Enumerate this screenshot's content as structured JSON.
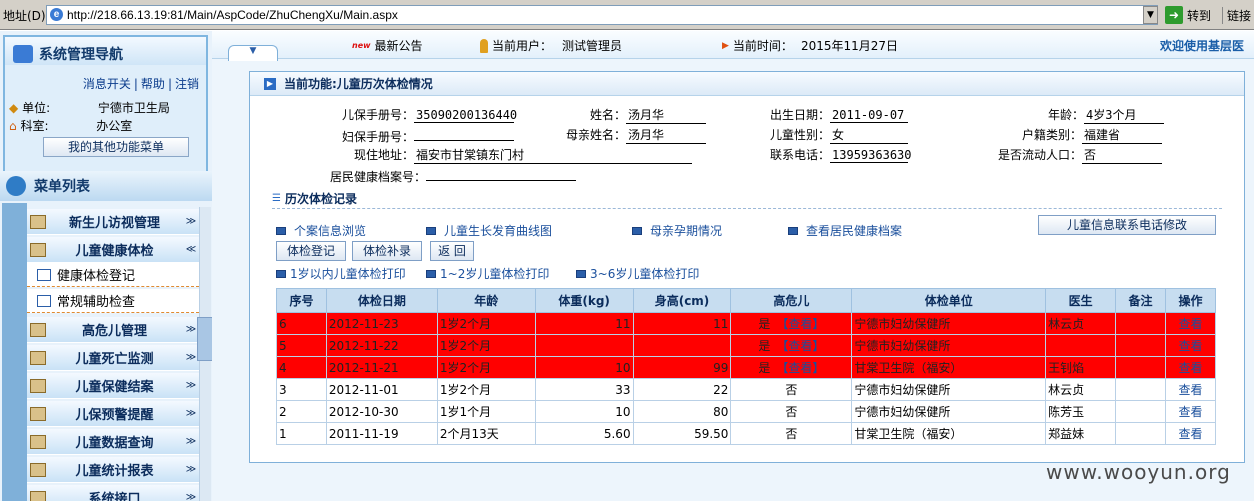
{
  "browser": {
    "address_label": "地址(D)",
    "url": "http://218.66.13.19:81/Main/AspCode/ZhuChengXu/Main.aspx",
    "go_label": "转到",
    "links_label": "链接"
  },
  "nav": {
    "title": "系统管理导航",
    "links": [
      "消息开关",
      "帮助",
      "注销"
    ],
    "unit_label": "单位:",
    "unit_value": "宁德市卫生局",
    "dept_label": "科室:",
    "dept_value": "办公室",
    "other_menu_button": "我的其他功能菜单",
    "menu_list_title": "菜单列表",
    "menu_items": [
      {
        "label": "新生儿访视管理",
        "chev": "≫"
      },
      {
        "label": "儿童健康体检",
        "chev": "≪"
      },
      {
        "label": "高危儿管理",
        "chev": "≫"
      },
      {
        "label": "儿童死亡监测",
        "chev": "≫"
      },
      {
        "label": "儿童保健结案",
        "chev": "≫"
      },
      {
        "label": "儿保预警提醒",
        "chev": "≫"
      },
      {
        "label": "儿童数据查询",
        "chev": "≫"
      },
      {
        "label": "儿童统计报表",
        "chev": "≫"
      },
      {
        "label": "系统接口",
        "chev": "≫"
      }
    ],
    "sub_items": [
      "健康体检登记",
      "常规辅助检查"
    ]
  },
  "topbar": {
    "new_badge": "new",
    "notice": "最新公告",
    "current_user_label": "当前用户：",
    "current_user": "测试管理员",
    "current_time_label": "当前时间：",
    "current_time": "2015年11月27日",
    "welcome": "欢迎使用基层医"
  },
  "panel": {
    "title": "当前功能:儿童历次体检情况",
    "fields": {
      "child_card_label": "儿保手册号：",
      "child_card": "35090200136440",
      "name_label": "姓名：",
      "name": "汤月华",
      "birth_label": "出生日期：",
      "birth": "2011-09-07",
      "age_label": "年龄：",
      "age": "4岁3个月",
      "mom_card_label": "妇保手册号：",
      "mom_card": "",
      "mom_name_label": "母亲姓名：",
      "mom_name": "汤月华",
      "gender_label": "儿童性别：",
      "gender": "女",
      "hukou_label": "户籍类别：",
      "hukou": "福建省",
      "addr_label": "现住地址：",
      "addr": "福安市甘棠镇东门村",
      "phone_label": "联系电话：",
      "phone": "13959363630",
      "floating_label": "是否流动人口：",
      "floating": "否",
      "health_file_label": "居民健康档案号：",
      "health_file": ""
    },
    "section_title": "历次体检记录",
    "links": [
      "个案信息浏览",
      "儿童生长发育曲线图",
      "母亲孕期情况",
      "查看居民健康档案"
    ],
    "phone_edit_button": "儿童信息联系电话修改",
    "buttons": [
      "体检登记",
      "体检补录",
      "返 回"
    ],
    "print_links": [
      "1岁以内儿童体检打印",
      "1~2岁儿童体检打印",
      "3~6岁儿童体检打印"
    ],
    "table": {
      "headers": [
        "序号",
        "体检日期",
        "年龄",
        "体重(kg)",
        "身高(cm)",
        "高危儿",
        "体检单位",
        "医生",
        "备注",
        "操作"
      ],
      "rows": [
        {
          "no": "6",
          "date": "2012-11-23",
          "age": "1岁2个月",
          "weight": "11",
          "height": "11",
          "risk": "是",
          "risk_link": "【查看】",
          "unit": "宁德市妇幼保健所",
          "doctor": "林云贞",
          "note": "",
          "op": "查看",
          "highlight": true
        },
        {
          "no": "5",
          "date": "2012-11-22",
          "age": "1岁2个月",
          "weight": "",
          "height": "",
          "risk": "是",
          "risk_link": "【查看】",
          "unit": "宁德市妇幼保健所",
          "doctor": "",
          "note": "",
          "op": "查看",
          "highlight": true
        },
        {
          "no": "4",
          "date": "2012-11-21",
          "age": "1岁2个月",
          "weight": "10",
          "height": "99",
          "risk": "是",
          "risk_link": "【查看】",
          "unit": "甘棠卫生院（福安）",
          "doctor": "王钊焰",
          "note": "",
          "op": "查看",
          "highlight": true
        },
        {
          "no": "3",
          "date": "2012-11-01",
          "age": "1岁2个月",
          "weight": "33",
          "height": "22",
          "risk": "否",
          "risk_link": "",
          "unit": "宁德市妇幼保健所",
          "doctor": "林云贞",
          "note": "",
          "op": "查看",
          "highlight": false
        },
        {
          "no": "2",
          "date": "2012-10-30",
          "age": "1岁1个月",
          "weight": "10",
          "height": "80",
          "risk": "否",
          "risk_link": "",
          "unit": "宁德市妇幼保健所",
          "doctor": "陈芳玉",
          "note": "",
          "op": "查看",
          "highlight": false
        },
        {
          "no": "1",
          "date": "2011-11-19",
          "age": "2个月13天",
          "weight": "5.60",
          "height": "59.50",
          "risk": "否",
          "risk_link": "",
          "unit": "甘棠卫生院（福安）",
          "doctor": "郑益妹",
          "note": "",
          "op": "查看",
          "highlight": false
        }
      ]
    }
  },
  "watermark": "www.wooyun.org"
}
